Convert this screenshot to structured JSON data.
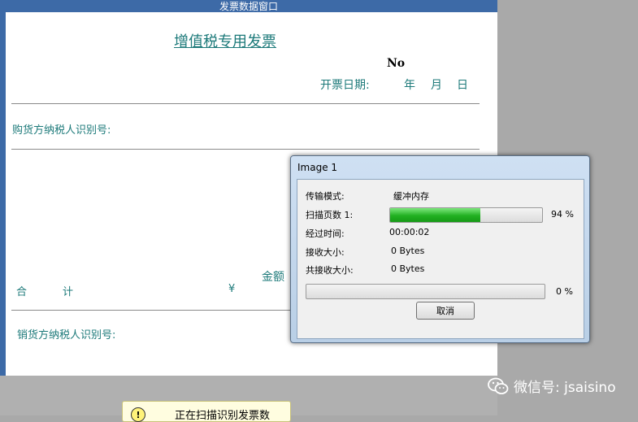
{
  "invoice_window": {
    "title": "发票数据窗口",
    "invoice_title": "增值税专用发票",
    "no_label": "No",
    "date_label": "开票日期:",
    "year": "年",
    "month": "月",
    "day": "日",
    "buyer_tax_id_label": "购货方纳税人识别号:",
    "amount_label": "金额",
    "total_he": "合",
    "total_ji": "计",
    "currency_symbol": "¥",
    "seller_tax_id_label": "销货方纳税人识别号:"
  },
  "scan_dialog": {
    "title": "Image 1",
    "transfer_mode_label": "传输模式:",
    "transfer_mode_value": "缓冲内存",
    "scan_pages_label": "扫描页数 1:",
    "scan_progress_percent": 94,
    "scan_progress_text": "94 %",
    "elapsed_label": "经过时间:",
    "elapsed_value": "00:00:02",
    "received_label": "接收大小:",
    "received_value": "0 Bytes",
    "total_received_label": "共接收大小:",
    "total_received_value": "0 Bytes",
    "overall_progress_percent": 0,
    "overall_progress_text": "0 %",
    "cancel_label": "取消"
  },
  "watermark": {
    "text": "微信号: jsaisino",
    "icon": "wechat-icon"
  },
  "toast": {
    "text": "正在扫描识别发票数",
    "icon": "warning-icon"
  },
  "colors": {
    "titlebar": "#3d6aa7",
    "label_teal": "#1d7a7a",
    "progress_green": "#21b021"
  }
}
